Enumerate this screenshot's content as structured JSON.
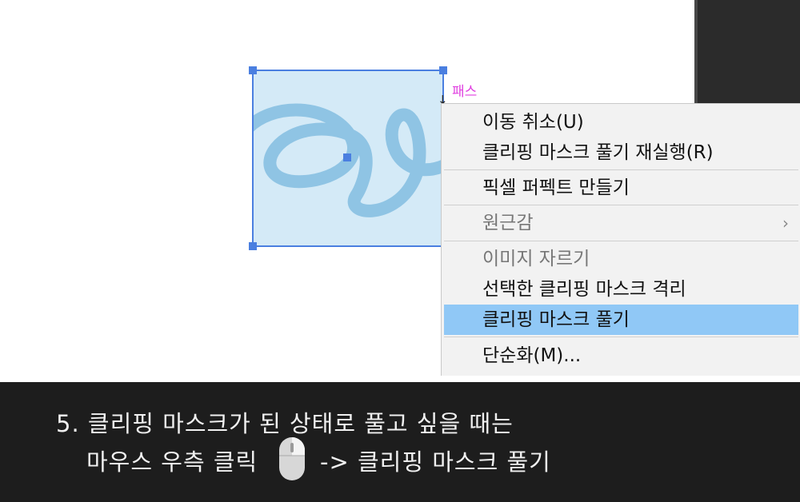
{
  "canvas": {
    "path_label": "패스",
    "colors": {
      "selection": "#4a7fe0",
      "fill": "#d4eaf7",
      "stroke": "#8fc4e4",
      "path_label": "#e040e0"
    }
  },
  "context_menu": {
    "items": [
      {
        "label": "이동 취소(U)",
        "disabled": false
      },
      {
        "label": "클리핑 마스크 풀기 재실행(R)",
        "disabled": false
      },
      {
        "label": "픽셀 퍼펙트 만들기",
        "disabled": false
      },
      {
        "label": "원근감",
        "disabled": true,
        "submenu": true
      },
      {
        "label": "이미지 자르기",
        "disabled": true
      },
      {
        "label": "선택한 클리핑 마스크 격리",
        "disabled": false
      },
      {
        "label": "클리핑 마스크 풀기",
        "disabled": false,
        "highlighted": true
      },
      {
        "label": "단순화(M)...",
        "disabled": false
      }
    ],
    "submenu_arrow": "›",
    "highlight_color": "#90c8f6"
  },
  "caption": {
    "line1": "5. 클리핑 마스크가 된 상태로 풀고 싶을 때는",
    "line2_before": "마우스 우측 클릭",
    "line2_after": "-> 클리핑 마스크 풀기",
    "mouse_icon": "mouse-right-click-icon"
  }
}
